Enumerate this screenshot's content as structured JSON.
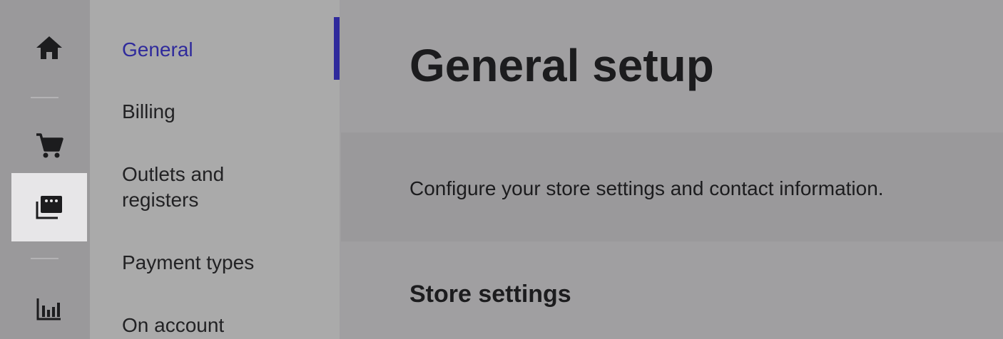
{
  "rail": {
    "items": [
      {
        "icon": "home-icon"
      },
      {
        "icon": "cart-icon"
      },
      {
        "icon": "setup-icon",
        "selected": true
      },
      {
        "icon": "reports-icon"
      }
    ]
  },
  "subnav": {
    "items": [
      {
        "label": "General",
        "active": true
      },
      {
        "label": "Billing"
      },
      {
        "label": "Outlets and registers"
      },
      {
        "label": "Payment types"
      },
      {
        "label": "On account"
      }
    ],
    "accent_color": "#2f2a9c"
  },
  "main": {
    "title": "General setup",
    "description": "Configure your store settings and contact information.",
    "section_title": "Store settings"
  }
}
